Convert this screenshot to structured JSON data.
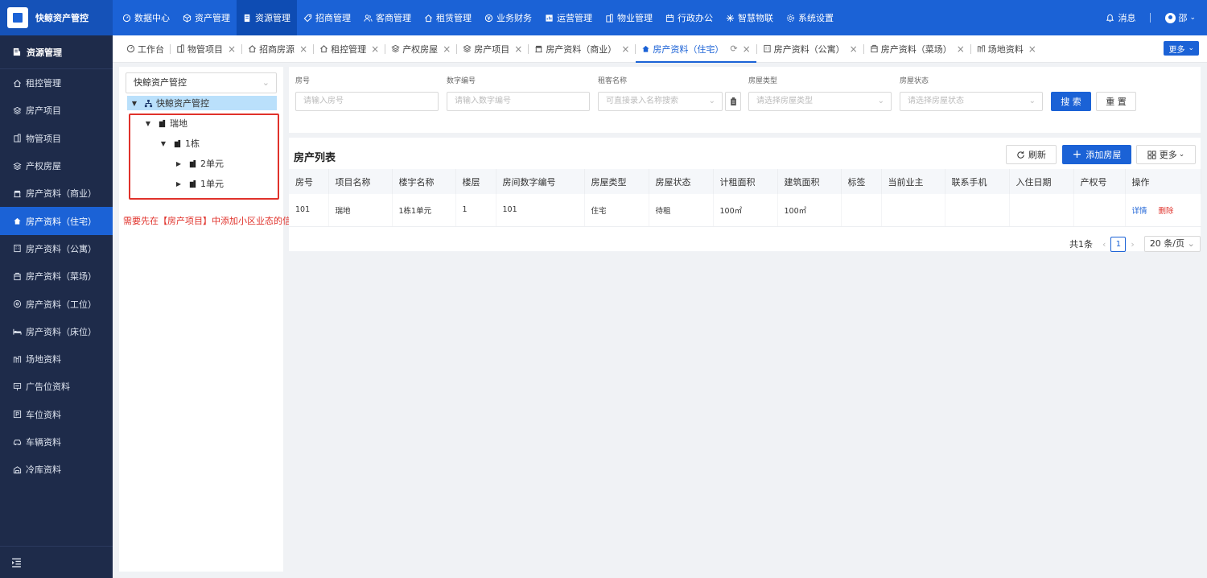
{
  "brand": {
    "name": "快鲸资产管控"
  },
  "topnav": [
    {
      "label": "数据中心",
      "icon": "dashboard-icon"
    },
    {
      "label": "资产管理",
      "icon": "cube-icon"
    },
    {
      "label": "资源管理",
      "icon": "document-icon",
      "active": true
    },
    {
      "label": "招商管理",
      "icon": "tag-icon"
    },
    {
      "label": "客商管理",
      "icon": "users-icon"
    },
    {
      "label": "租赁管理",
      "icon": "home-icon"
    },
    {
      "label": "业务财务",
      "icon": "money-icon"
    },
    {
      "label": "运营管理",
      "icon": "report-icon"
    },
    {
      "label": "物业管理",
      "icon": "building-icon"
    },
    {
      "label": "行政办公",
      "icon": "calendar-icon"
    },
    {
      "label": "智慧物联",
      "icon": "network-icon"
    },
    {
      "label": "系统设置",
      "icon": "gear-icon"
    }
  ],
  "topright": {
    "messages": "消息",
    "user": "邵"
  },
  "sidebar": {
    "header": "资源管理",
    "items": [
      {
        "label": "租控管理",
        "icon": "home-icon"
      },
      {
        "label": "房产项目",
        "icon": "layers-icon"
      },
      {
        "label": "物管项目",
        "icon": "building-icon"
      },
      {
        "label": "产权房屋",
        "icon": "layers-icon"
      },
      {
        "label": "房产资料（商业）",
        "icon": "shop-icon"
      },
      {
        "label": "房产资料（住宅）",
        "icon": "house-icon",
        "active": true
      },
      {
        "label": "房产资料（公寓）",
        "icon": "apartment-icon"
      },
      {
        "label": "房产资料（菜场）",
        "icon": "market-icon"
      },
      {
        "label": "房产资料（工位）",
        "icon": "desk-icon"
      },
      {
        "label": "房产资料（床位）",
        "icon": "bed-icon"
      },
      {
        "label": "场地资料",
        "icon": "field-icon"
      },
      {
        "label": "广告位资料",
        "icon": "billboard-icon"
      },
      {
        "label": "车位资料",
        "icon": "parking-icon"
      },
      {
        "label": "车辆资料",
        "icon": "car-icon"
      },
      {
        "label": "冷库资料",
        "icon": "warehouse-icon"
      }
    ]
  },
  "tabs": [
    {
      "label": "工作台",
      "icon": "dashboard-icon"
    },
    {
      "label": "物管项目",
      "icon": "building-icon"
    },
    {
      "label": "招商房源",
      "icon": "home-icon"
    },
    {
      "label": "租控管理",
      "icon": "home-icon"
    },
    {
      "label": "产权房屋",
      "icon": "layers-icon"
    },
    {
      "label": "房产项目",
      "icon": "layers-icon"
    },
    {
      "label": "房产资料（商业）",
      "icon": "shop-icon"
    },
    {
      "label": "房产资料（住宅）",
      "icon": "house-icon",
      "active": true
    },
    {
      "label": "房产资料（公寓）",
      "icon": "apartment-icon"
    },
    {
      "label": "房产资料（菜场）",
      "icon": "market-icon"
    },
    {
      "label": "场地资料",
      "icon": "field-icon"
    }
  ],
  "tabs_more": "更多",
  "tree": {
    "select_value": "快鲸资产管控",
    "root": "快鲸资产管控",
    "nodes": [
      "瑞地",
      "1栋",
      "2单元",
      "1单元"
    ],
    "hint": "需要先在【房产项目】中添加小区业态的信息"
  },
  "search": {
    "room_no": {
      "label": "房号",
      "placeholder": "请输入房号"
    },
    "digital_no": {
      "label": "数字编号",
      "placeholder": "请输入数字编号"
    },
    "tenant": {
      "label": "租客名称",
      "placeholder": "可直接录入名称搜索"
    },
    "house_type": {
      "label": "房屋类型",
      "placeholder": "请选择房屋类型"
    },
    "house_status": {
      "label": "房屋状态",
      "placeholder": "请选择房屋状态"
    },
    "search_btn": "搜 索",
    "reset_btn": "重 置"
  },
  "list": {
    "title": "房产列表",
    "refresh_btn": "刷新",
    "add_btn": "添加房屋",
    "more_btn": "更多",
    "columns": [
      "房号",
      "项目名称",
      "楼宇名称",
      "楼层",
      "房间数字编号",
      "房屋类型",
      "房屋状态",
      "计租面积",
      "建筑面积",
      "标签",
      "当前业主",
      "联系手机",
      "入住日期",
      "产权号",
      "操作"
    ],
    "rows": [
      [
        "101",
        "瑞地",
        "1栋1单元",
        "1",
        "101",
        "住宅",
        "待租",
        "100㎡",
        "100㎡",
        "",
        "",
        "",
        "",
        ""
      ]
    ],
    "action_detail": "详情",
    "action_delete": "删除"
  },
  "pager": {
    "total": "共1条",
    "page": "1",
    "size": "20 条/页"
  },
  "colors": {
    "primary": "#1b62d6",
    "sidebar": "#1e2b4a",
    "danger": "#e0322b"
  }
}
